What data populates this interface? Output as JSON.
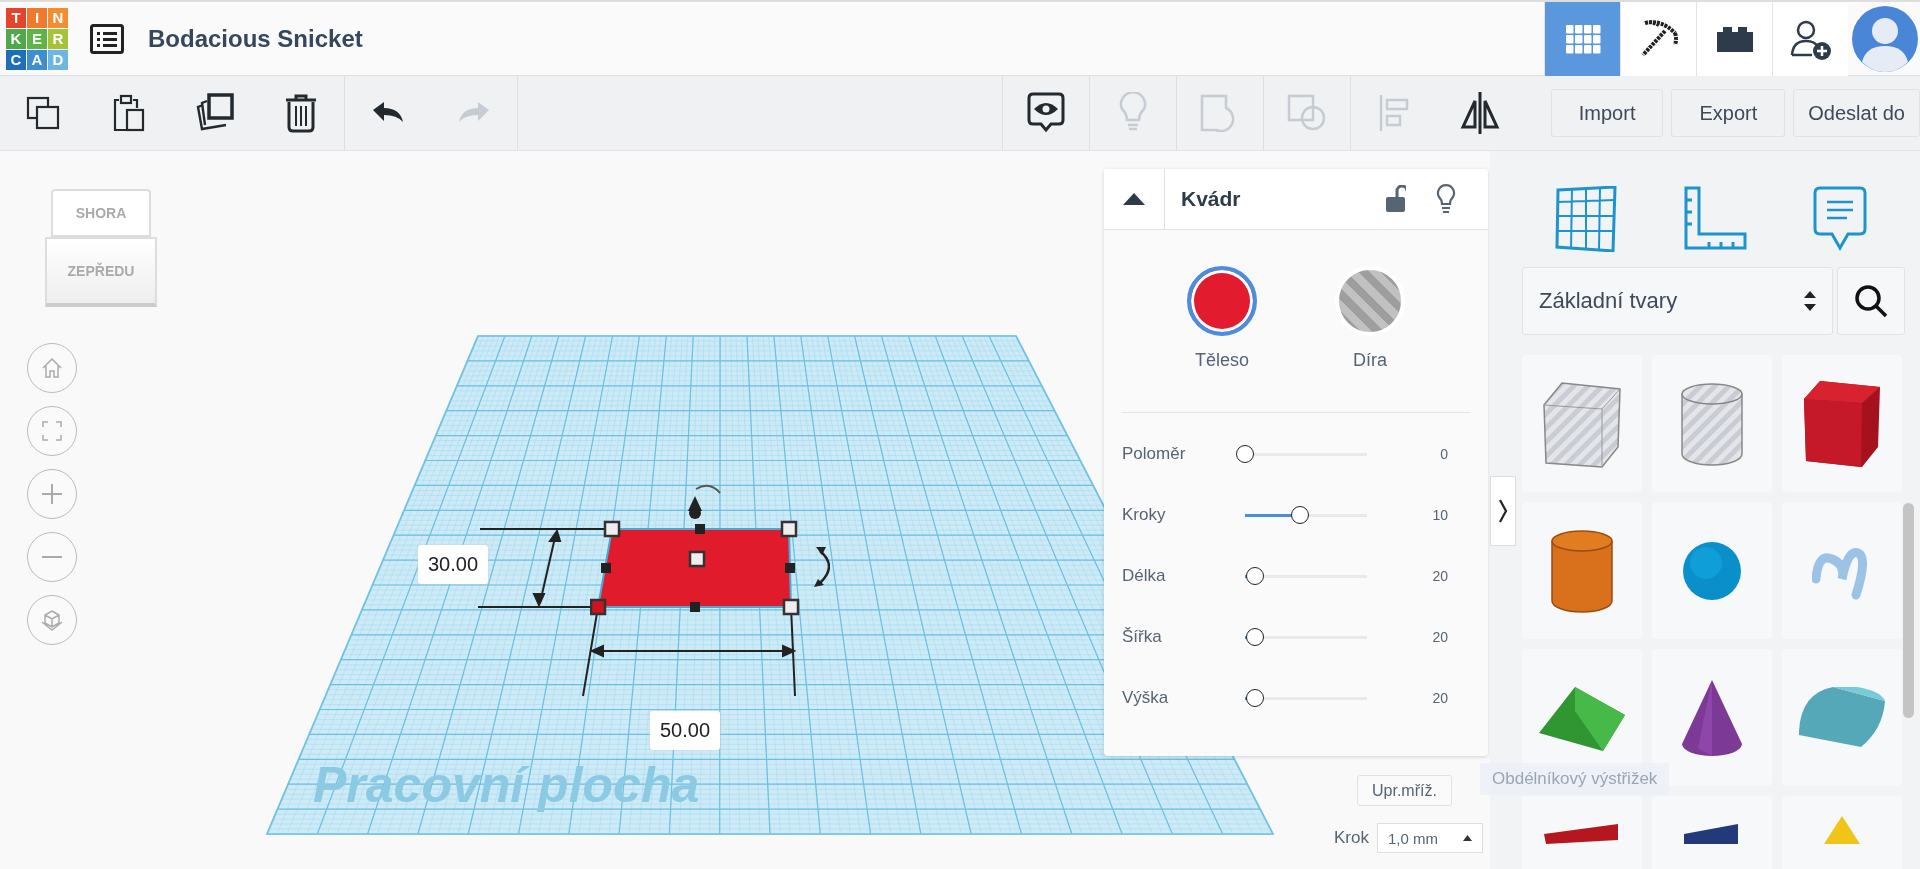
{
  "header": {
    "logo_letters": [
      "T",
      "I",
      "N",
      "K",
      "E",
      "R",
      "C",
      "A",
      "D"
    ],
    "title": "Bodacious Snicket",
    "view_modes": [
      {
        "kind": "grid",
        "selected": true
      },
      {
        "kind": "pickaxe",
        "selected": false
      },
      {
        "kind": "bricks",
        "selected": false
      }
    ]
  },
  "toolbar": {
    "left_tools": [
      {
        "kind": "copy",
        "disabled": false
      },
      {
        "kind": "paste",
        "disabled": false
      },
      {
        "kind": "duplicate",
        "disabled": false
      },
      {
        "kind": "delete",
        "disabled": false
      },
      {
        "kind": "undo",
        "disabled": false
      },
      {
        "kind": "redo",
        "disabled": true
      }
    ],
    "right_tools": [
      {
        "kind": "notes",
        "disabled": false
      },
      {
        "kind": "bulb",
        "disabled": true
      },
      {
        "kind": "group",
        "disabled": true
      },
      {
        "kind": "ungroup",
        "disabled": true
      },
      {
        "kind": "align",
        "disabled": true
      },
      {
        "kind": "mirror",
        "disabled": false
      }
    ],
    "buttons": [
      "Import",
      "Export",
      "Odeslat do"
    ]
  },
  "view_cube": {
    "top": "SHORA",
    "front": "ZEPŘEDU"
  },
  "workplane": {
    "label": "Pracovní plocha",
    "depth_label": "30.00",
    "width_label": "50.00"
  },
  "inspector": {
    "title": "Kvádr",
    "materials": [
      {
        "kind": "solid",
        "label": "Těleso",
        "selected": true
      },
      {
        "kind": "hole",
        "label": "Díra",
        "selected": false
      }
    ],
    "sliders": [
      {
        "label": "Poloměr",
        "level": 0,
        "value": "0"
      },
      {
        "label": "Kroky",
        "level": 0.45,
        "value": "10"
      },
      {
        "label": "Délka",
        "level": 0.08,
        "value": "20"
      },
      {
        "label": "Šířka",
        "level": 0.08,
        "value": "20"
      },
      {
        "label": "Výška",
        "level": 0.08,
        "value": "20"
      }
    ]
  },
  "grid_controls": {
    "edit_grid": "Upr.mříž.",
    "snap_label": "Krok",
    "snap_value": "1,0 mm"
  },
  "tooltip": "Obdélníkový výstřižek",
  "library": {
    "category": "Základní tvary",
    "shapes": [
      {
        "kind": "box_hole"
      },
      {
        "kind": "cylinder_hole"
      },
      {
        "kind": "box"
      },
      {
        "kind": "cylinder"
      },
      {
        "kind": "sphere"
      },
      {
        "kind": "scribble"
      },
      {
        "kind": "roof"
      },
      {
        "kind": "cone"
      },
      {
        "kind": "round_roof"
      },
      {
        "kind": "text"
      },
      {
        "kind": "wedge"
      },
      {
        "kind": "pyramid"
      }
    ]
  }
}
